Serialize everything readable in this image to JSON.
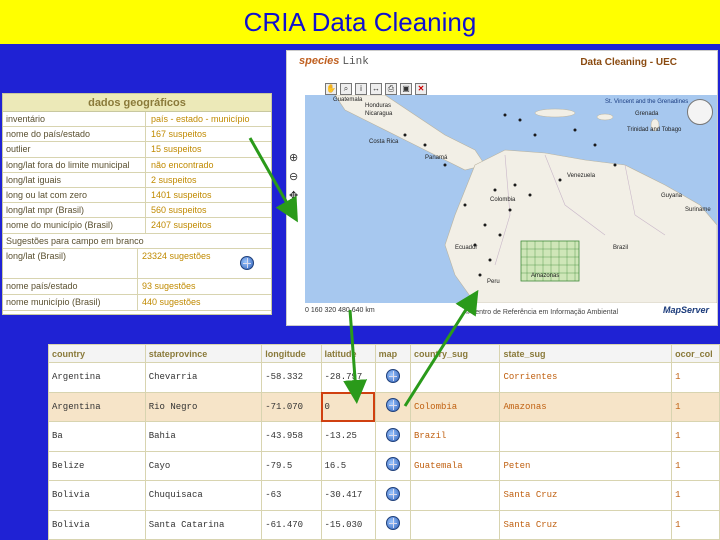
{
  "title": "CRIA Data Cleaning",
  "geo_panel": {
    "header": "dados geográficos",
    "rows": [
      {
        "label": "inventário",
        "value": "país - estado - município"
      },
      {
        "label": "nome do país/estado",
        "value": "167 suspeitos"
      },
      {
        "label": "outlier",
        "value": "15 suspeitos"
      },
      {
        "label": "long/lat fora do limite municipal",
        "value": "não encontrado"
      },
      {
        "label": "long/lat iguais",
        "value": "2 suspeitos"
      },
      {
        "label": "long ou lat com zero",
        "value": "1401 suspeitos"
      },
      {
        "label": "long/lat mpr (Brasil)",
        "value": "560 suspeitos"
      },
      {
        "label": "nome do município (Brasil)",
        "value": "2407 suspeitos"
      }
    ],
    "suggestion_label": "Sugestões para campo em branco",
    "suggestion_rows": [
      {
        "label": "long/lat (Brasil)",
        "value": "23324 sugestões",
        "globe": true
      },
      {
        "label": "nome país/estado",
        "value": "93 sugestões",
        "globe": false
      },
      {
        "label": "nome município (Brasil)",
        "value": "440 sugestões",
        "globe": false
      }
    ]
  },
  "map": {
    "brand_prefix": "species",
    "brand_suffix": "Link",
    "header": "Data Cleaning - UEC",
    "scale": "0   160  320  480  640 km",
    "credit": "©Centro de Referência em Informação Ambiental",
    "logo": "MapServer",
    "places": [
      {
        "name": "Guatemala",
        "sea": false
      },
      {
        "name": "Honduras",
        "sea": false
      },
      {
        "name": "Nicaragua",
        "sea": false
      },
      {
        "name": "Costa Rica",
        "sea": false
      },
      {
        "name": "Panamá",
        "sea": false
      },
      {
        "name": "Colombia",
        "sea": false
      },
      {
        "name": "Venezuela",
        "sea": false
      },
      {
        "name": "Ecuador",
        "sea": false
      },
      {
        "name": "Peru",
        "sea": false
      },
      {
        "name": "Brazil",
        "sea": false
      },
      {
        "name": "Amazonas",
        "sea": false
      },
      {
        "name": "Guyana",
        "sea": false
      },
      {
        "name": "Suriname",
        "sea": false
      },
      {
        "name": "St. Vincent and the Grenadines",
        "sea": true
      },
      {
        "name": "Grenada",
        "sea": false
      },
      {
        "name": "Trinidad and Tobago",
        "sea": false
      }
    ]
  },
  "table": {
    "headers": [
      "country",
      "stateprovince",
      "longitude",
      "latitude",
      "map",
      "country_sug",
      "state_sug",
      "ocor_col"
    ],
    "rows": [
      {
        "country": "Argentina",
        "state": "Chevarria",
        "lon": "-58.332",
        "lat": "-28.797",
        "country_sug": "",
        "state_sug": "Corrientes",
        "ocor": "1",
        "hl": false
      },
      {
        "country": "Argentina",
        "state": "Rio Negro",
        "lon": "-71.070",
        "lat": "0",
        "country_sug": "Colombia",
        "state_sug": "Amazonas",
        "ocor": "1",
        "hl": true
      },
      {
        "country": "Ba",
        "state": "Bahia",
        "lon": "-43.958",
        "lat": "-13.25",
        "country_sug": "Brazil",
        "state_sug": "",
        "ocor": "1",
        "hl": false
      },
      {
        "country": "Belize",
        "state": "Cayo",
        "lon": "-79.5",
        "lat": "16.5",
        "country_sug": "Guatemala",
        "state_sug": "Peten",
        "ocor": "1",
        "hl": false
      },
      {
        "country": "Bolivia",
        "state": "Chuquisaca",
        "lon": "-63",
        "lat": "-30.417",
        "country_sug": "",
        "state_sug": "Santa Cruz",
        "ocor": "1",
        "hl": false
      },
      {
        "country": "Bolivia",
        "state": "Santa Catarina",
        "lon": "-61.470",
        "lat": "-15.030",
        "country_sug": "",
        "state_sug": "Santa Cruz",
        "ocor": "1",
        "hl": false
      }
    ]
  },
  "colors": {
    "background": "#1f22d4",
    "title_bg": "#ffff00",
    "highlight": "#f6e4c8",
    "arrow": "#2a9a1a",
    "selection": "#d04010"
  }
}
